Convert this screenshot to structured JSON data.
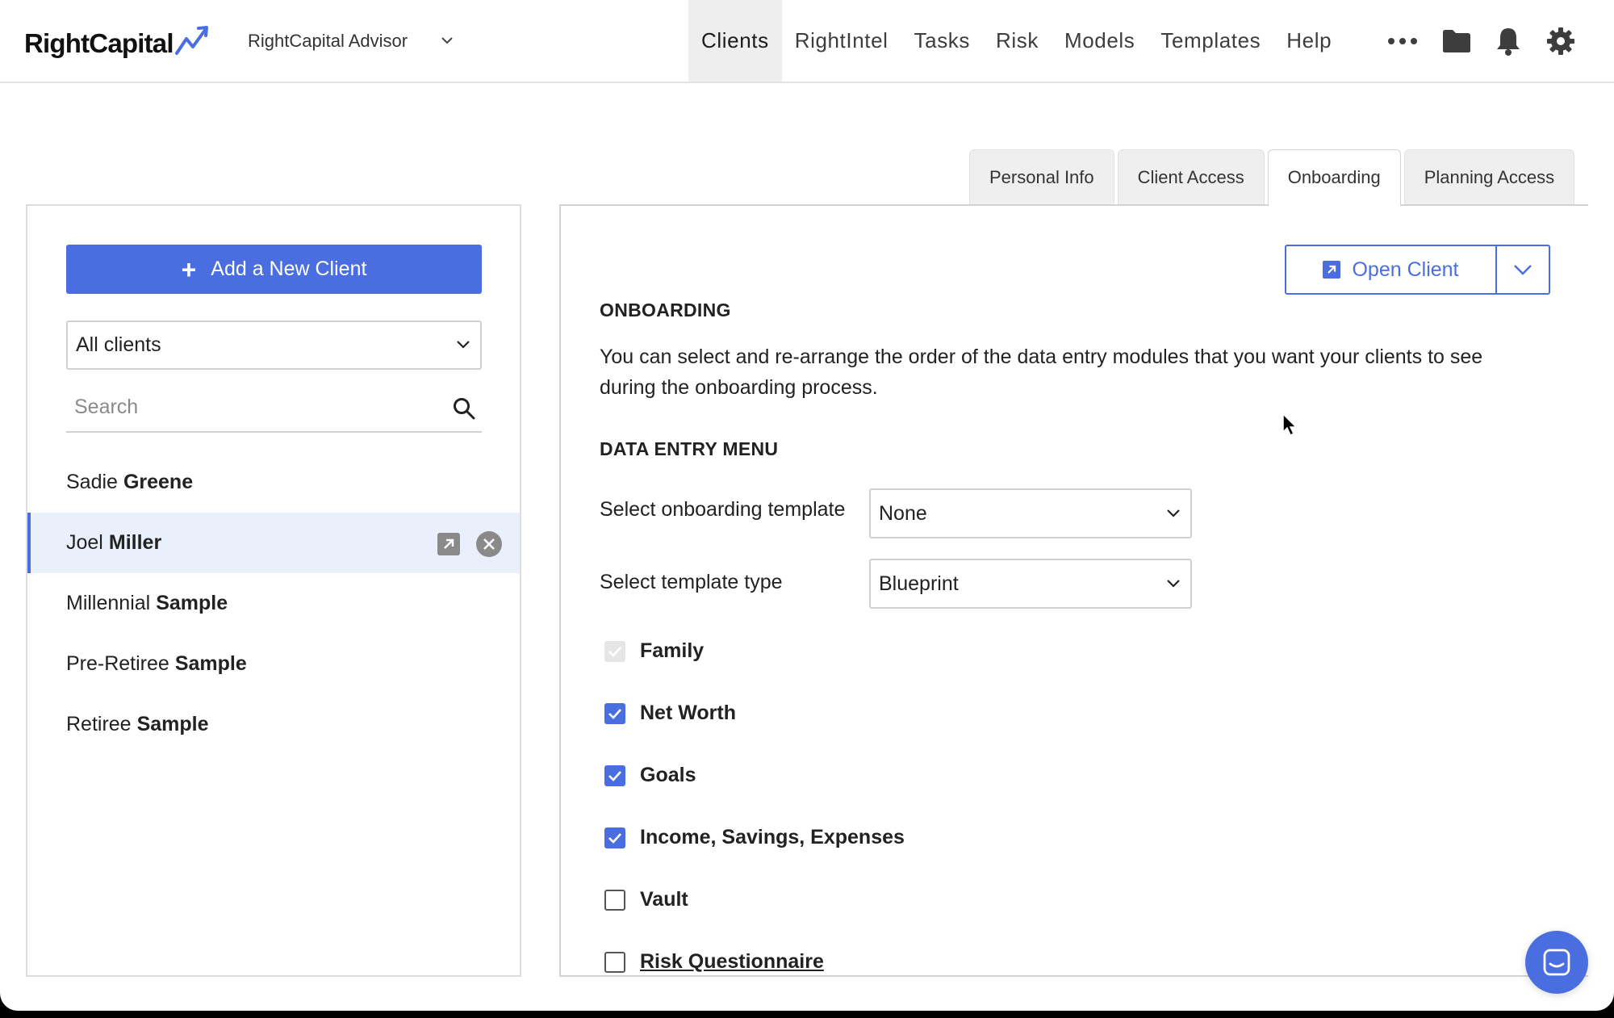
{
  "app": {
    "logo_text": "RightCapital",
    "advisor": "RightCapital Advisor"
  },
  "nav": {
    "items": [
      "Clients",
      "RightIntel",
      "Tasks",
      "Risk",
      "Models",
      "Templates",
      "Help"
    ],
    "active": "Clients",
    "icons": [
      "more-icon",
      "folder-icon",
      "bell-icon",
      "gear-icon"
    ]
  },
  "tabs": {
    "items": [
      "Personal Info",
      "Client Access",
      "Onboarding",
      "Planning Access"
    ],
    "active": "Onboarding"
  },
  "sidebar": {
    "add_label": "Add a New Client",
    "filter_value": "All clients",
    "search_placeholder": "Search",
    "clients": [
      {
        "first": "Sadie",
        "last": "Greene"
      },
      {
        "first": "Joel",
        "last": "Miller"
      },
      {
        "first": "Millennial",
        "last": "Sample"
      },
      {
        "first": "Pre-Retiree",
        "last": "Sample"
      },
      {
        "first": "Retiree",
        "last": "Sample"
      }
    ],
    "selected_client": "Joel Miller"
  },
  "main": {
    "open_client_label": "Open Client",
    "heading": "ONBOARDING",
    "description": "You can select and re-arrange the order of the data entry modules that you want your clients to see during the onboarding process.",
    "menu_heading": "DATA ENTRY MENU",
    "template_label": "Select onboarding template",
    "template_value": "None",
    "type_label": "Select template type",
    "type_value": "Blueprint",
    "modules": [
      {
        "label": "Family",
        "state": "checked-disabled"
      },
      {
        "label": "Net Worth",
        "state": "checked"
      },
      {
        "label": "Goals",
        "state": "checked"
      },
      {
        "label": "Income, Savings, Expenses",
        "state": "checked"
      },
      {
        "label": "Vault",
        "state": "unchecked"
      },
      {
        "label": "Risk Questionnaire",
        "state": "unchecked"
      }
    ]
  },
  "colors": {
    "accent": "#4a6ee0",
    "selected_row": "#eaf0fb",
    "nav_active_bg": "#eeeeee"
  }
}
